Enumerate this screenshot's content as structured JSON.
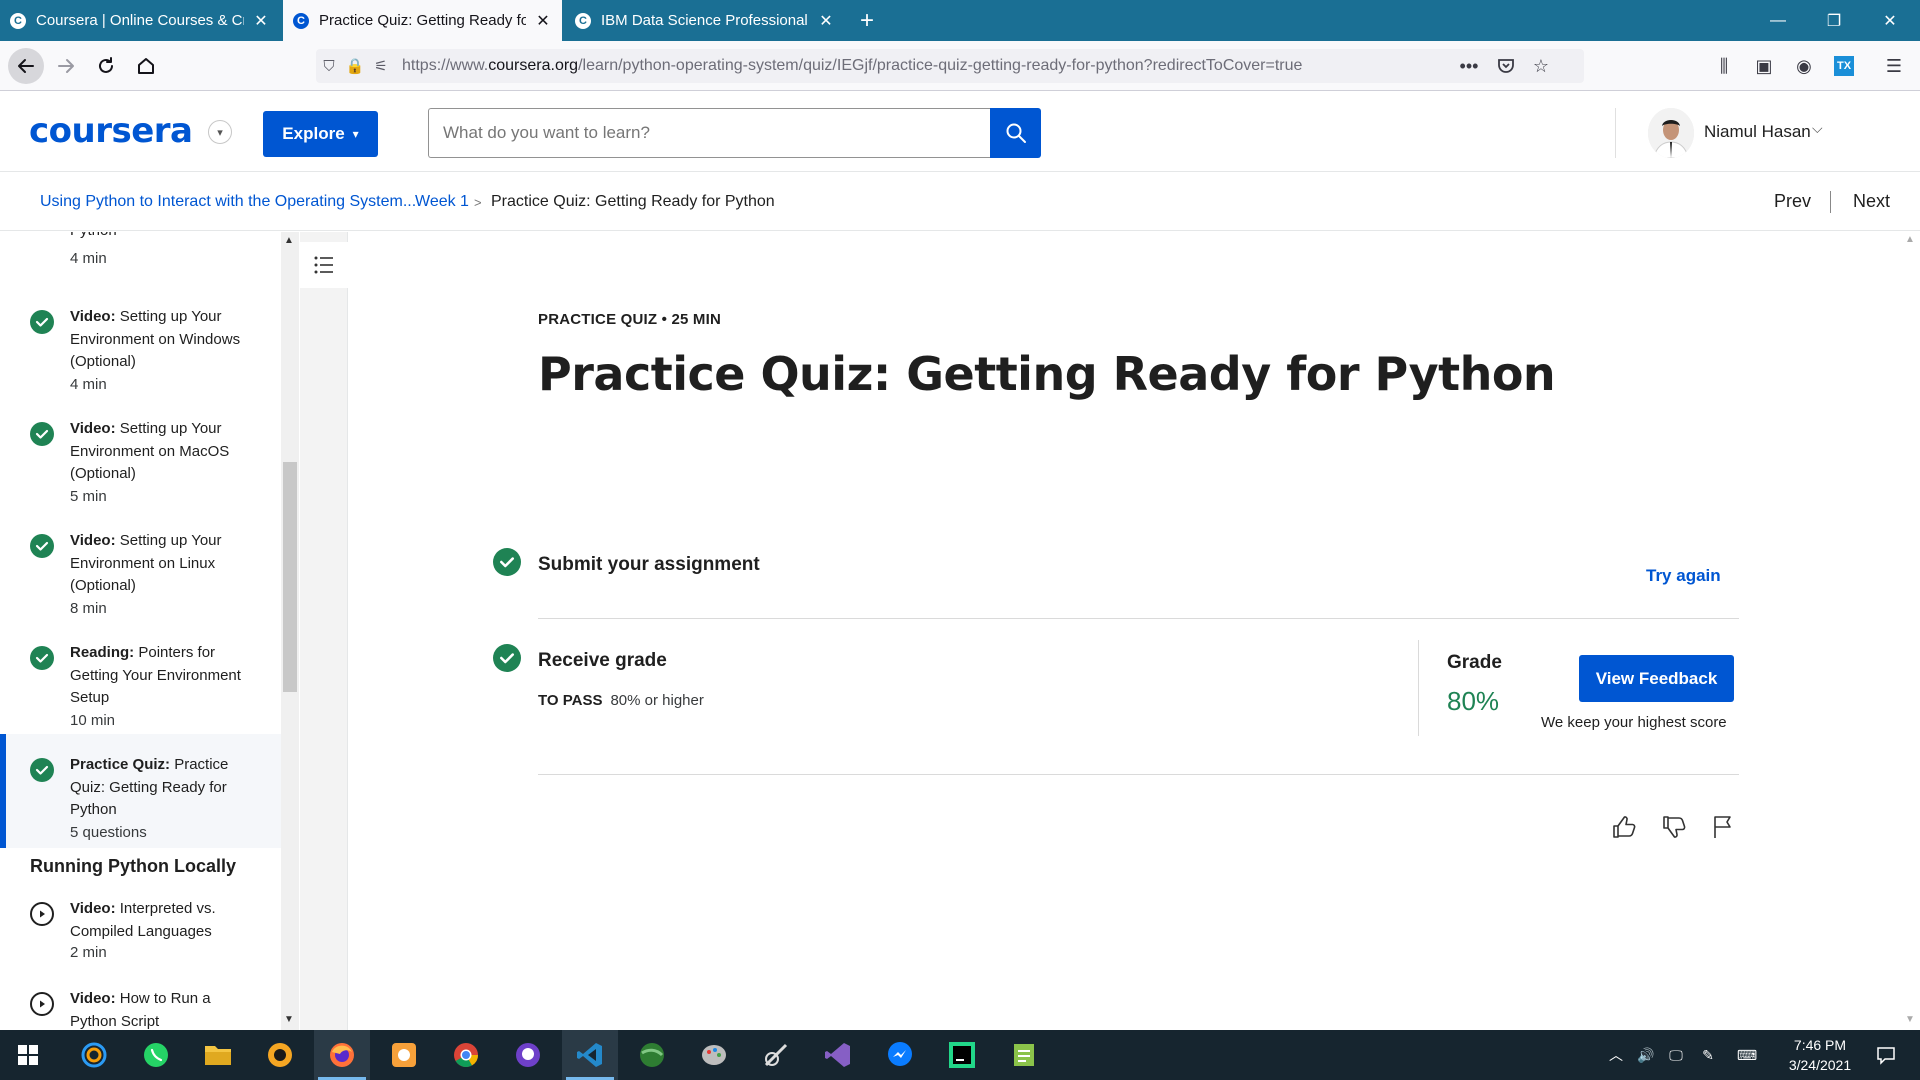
{
  "browser": {
    "tabs": [
      {
        "title": "Coursera | Online Courses & Cr",
        "active": false
      },
      {
        "title": "Practice Quiz: Getting Ready fo",
        "active": true
      },
      {
        "title": "IBM Data Science Professional",
        "active": false
      }
    ],
    "url_prefix": "https://www.",
    "url_domain": "coursera.org",
    "url_rest": "/learn/python-operating-system/quiz/IEGjf/practice-quiz-getting-ready-for-python?redirectToCover=true"
  },
  "header": {
    "logo": "coursera",
    "explore_label": "Explore",
    "search_placeholder": "What do you want to learn?",
    "user_name": "Niamul Hasan"
  },
  "breadcrumb": {
    "course": "Using Python to Interact with the Operating System...",
    "week": "Week 1",
    "separator": ">",
    "current": "Practice Quiz: Getting Ready for Python",
    "prev_label": "Prev",
    "next_label": "Next"
  },
  "sidebar": {
    "partial_item": {
      "title_tail": "Python",
      "duration": "4 min"
    },
    "items": [
      {
        "type": "Video:",
        "title": "Setting up Your Environment on Windows (Optional)",
        "duration": "4 min",
        "done": true
      },
      {
        "type": "Video:",
        "title": "Setting up Your Environment on MacOS (Optional)",
        "duration": "5 min",
        "done": true
      },
      {
        "type": "Video:",
        "title": "Setting up Your Environment on Linux (Optional)",
        "duration": "8 min",
        "done": true
      },
      {
        "type": "Reading:",
        "title": "Pointers for Getting Your Environment Setup",
        "duration": "10 min",
        "done": true
      },
      {
        "type": "Practice Quiz:",
        "title": "Practice Quiz: Getting Ready for Python",
        "duration": "5 questions",
        "done": true,
        "active": true
      }
    ],
    "section_title": "Running Python Locally",
    "section_items": [
      {
        "type": "Video:",
        "title": "Interpreted vs. Compiled Languages",
        "duration": "2 min"
      },
      {
        "type": "Video:",
        "title": "How to Run a Python Script",
        "duration": ""
      }
    ]
  },
  "main": {
    "kicker": "PRACTICE QUIZ • 25 MIN",
    "title": "Practice Quiz: Getting Ready for Python",
    "step1_title": "Submit your assignment",
    "try_again": "Try again",
    "step2_title": "Receive grade",
    "to_pass_label": "TO PASS",
    "to_pass_value": "80% or higher",
    "grade_label": "Grade",
    "grade_value": "80%",
    "view_feedback": "View Feedback",
    "highest_note": "We keep your highest score"
  },
  "taskbar": {
    "time": "7:46 PM",
    "date": "3/24/2021"
  },
  "colors": {
    "brand_blue": "#0056d2",
    "success_green": "#1f8354",
    "firefox_tabbar": "#1a6f94",
    "taskbar": "#16252f"
  }
}
